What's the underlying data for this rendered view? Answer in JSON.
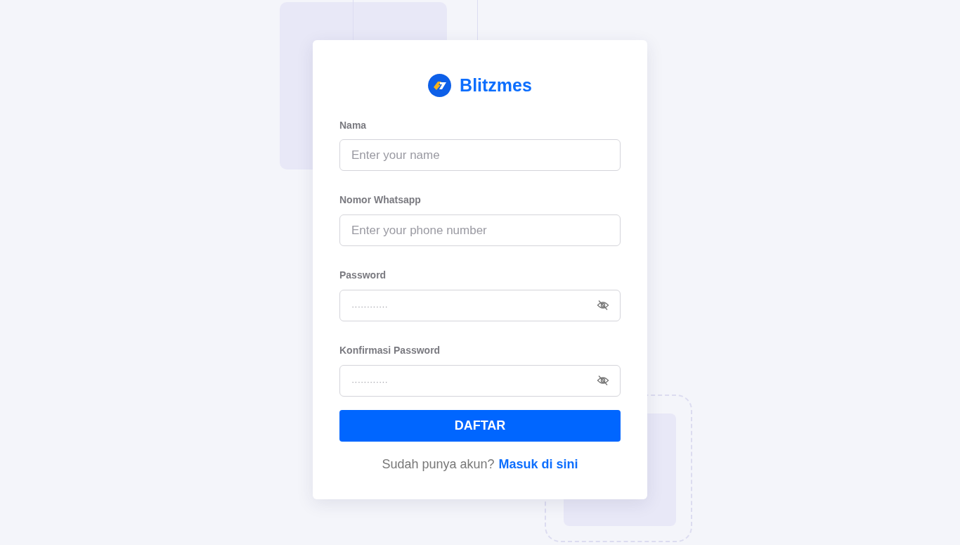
{
  "logo": {
    "name": "Blitzmes"
  },
  "fields": [
    {
      "kind": "text",
      "label": "Nama",
      "placeholder": "Enter your name"
    },
    {
      "kind": "text",
      "label": "Nomor Whatsapp",
      "placeholder": "Enter your phone number"
    },
    {
      "kind": "password",
      "label": "Password",
      "placeholder": "············"
    },
    {
      "kind": "password",
      "label": "Konfirmasi Password",
      "placeholder": "············"
    }
  ],
  "submit": "DAFTAR",
  "footer": {
    "text": "Sudah punya akun?",
    "link": "Masuk di sini"
  }
}
